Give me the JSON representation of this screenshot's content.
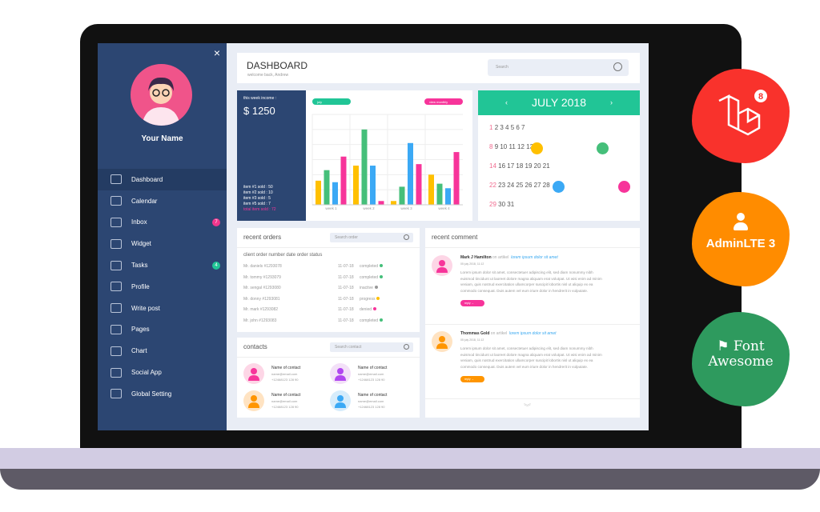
{
  "sidebar": {
    "close": "×",
    "user_name": "Your Name",
    "items": [
      {
        "label": "Dashboard",
        "icon": "book-icon",
        "active": true
      },
      {
        "label": "Calendar",
        "icon": "calendar-icon"
      },
      {
        "label": "Inbox",
        "icon": "envelope-icon",
        "badge": "7",
        "badge_color": "#f0368c"
      },
      {
        "label": "Widget",
        "icon": "grid-icon"
      },
      {
        "label": "Tasks",
        "icon": "tag-icon",
        "badge": "4",
        "badge_color": "#21c596"
      },
      {
        "label": "Profile",
        "icon": "user-circle-icon"
      },
      {
        "label": "Write post",
        "icon": "pencil-icon"
      },
      {
        "label": "Pages",
        "icon": "document-icon"
      },
      {
        "label": "Chart",
        "icon": "line-chart-icon"
      },
      {
        "label": "Social App",
        "icon": "chat-bubble-icon"
      },
      {
        "label": "Global Setting",
        "icon": "gear-icon"
      }
    ]
  },
  "header": {
    "title": "DASHBOARD",
    "subtitle": "welcome back, Andrew",
    "search_placeholder": "Search"
  },
  "income": {
    "label": "this week income :",
    "amount": "$ 1250",
    "items": [
      "item #1 sold : 50",
      "item #2 sold : 10",
      "item #3 sold : 5",
      "item #5 sold : 7"
    ],
    "total": "total item sold : 72"
  },
  "chart_data": {
    "type": "bar",
    "categories": [
      "week 1",
      "week 2",
      "week 3",
      "week 4"
    ],
    "ylim": [
      0,
      60
    ],
    "grid": true,
    "filter_month": "july",
    "filter_view": "view monthly",
    "colors": [
      "#ffc000",
      "#45bf7a",
      "#3ba9f5",
      "#f7349a"
    ],
    "series": [
      {
        "values": [
          16,
          26,
          2.5,
          20
        ]
      },
      {
        "values": [
          23,
          50,
          12,
          14
        ]
      },
      {
        "values": [
          15,
          26,
          41,
          11
        ]
      },
      {
        "values": [
          32,
          2.5,
          27,
          35
        ]
      }
    ]
  },
  "calendar": {
    "month": "JULY 2018",
    "prev": "‹",
    "next": "›",
    "weeks": [
      [
        "1",
        "2 3 4 5 6 7"
      ],
      [
        "8",
        "9 10 11 12 13"
      ],
      [
        "14",
        "16 17 18 19 20 21"
      ],
      [
        "22",
        "23 24 25 26 27 28"
      ],
      [
        "29",
        "30 31"
      ]
    ]
  },
  "orders": {
    "title": "recent orders",
    "search_placeholder": "Search order",
    "header": "client order number date order status",
    "rows": [
      {
        "client": "Mr. daniels #1293078",
        "date": "11-07-18",
        "status": "completed",
        "color": "#45bf7a"
      },
      {
        "client": "Mr. tommy #1293079",
        "date": "11-07-18",
        "status": "completed",
        "color": "#45bf7a"
      },
      {
        "client": "Mr. sengal #1293080",
        "date": "11-07-18",
        "status": "inactive",
        "color": "#999999"
      },
      {
        "client": "Mr. donny #1293081",
        "date": "11-07-18",
        "status": "progress",
        "color": "#ffc000"
      },
      {
        "client": "Mr. mark #1293082",
        "date": "11-07-18",
        "status": "denied",
        "color": "#f7349a"
      },
      {
        "client": "Mr. john #1293083",
        "date": "11-07-18",
        "status": "completed",
        "color": "#45bf7a"
      }
    ]
  },
  "contacts": {
    "title": "contacts",
    "search_placeholder": "Search contact",
    "items": [
      {
        "name": "Name of contact",
        "email": "name@email.com",
        "phone": "+12468123 128 90",
        "color": "#f7349a",
        "bg": "#fdd6e6"
      },
      {
        "name": "Name of contact",
        "email": "name@email.com",
        "phone": "+12468123 128 90",
        "color": "#b146f0",
        "bg": "#f3e0f8"
      },
      {
        "name": "Name of contact",
        "email": "name@email.com",
        "phone": "+12468123 128 90",
        "color": "#ff9500",
        "bg": "#ffe3c2"
      },
      {
        "name": "Name of contact",
        "email": "name@email.com",
        "phone": "+12468123 128 90",
        "color": "#3ba9f5",
        "bg": "#d6ecfb"
      }
    ]
  },
  "comments": {
    "title": "recent comment",
    "items": [
      {
        "name": "Mark J Hamilton",
        "on": "on artikel",
        "link": "lorem ipsum dolor sit amet",
        "date": "05 july 2018, 11:12",
        "text": "Lorem ipsum dolor sit amet, consectetuer adipiscing elit, sed diam nonummy nibh euismod tincidunt ut laoreet dolore magna aliquam erat volutpat. Ut wisi enim ad minim veniam, quis nostrud exercitation ullamcorper suscipit lobortis nisl ut aliquip ex ea commodo consequat. Duis autem vel eum iriure dolor in hendrerit in vulputate.",
        "reply": "reply  →",
        "color": "#f7349a",
        "bg": "#fdd6e6"
      },
      {
        "name": "Thommas Gold",
        "on": "on artikel",
        "link": "lorem ipsum dolor sit amet",
        "date": "05 july 2018, 11:12",
        "text": "Lorem ipsum dolor sit amet, consectetuer adipiscing elit, sed diam nonummy nibh euismod tincidunt ut laoreet dolore magna aliquam erat volutpat. Ut wisi enim ad minim veniam, quis nostrud exercitation ullamcorper suscipit lobortis nisl ut aliquip ex ea commodo consequat. Duis autem vel eum iriure dolor in hendrerit in vulputate.",
        "reply": "reply  →",
        "color": "#ff9500",
        "bg": "#ffe3c2"
      }
    ]
  },
  "badges": [
    {
      "label": "8",
      "name": "Laravel",
      "color": "#f9322c"
    },
    {
      "label": "AdminLTE 3",
      "color": "#ff8c00"
    },
    {
      "label": "Font Awesome",
      "color": "#2e9a5e"
    }
  ]
}
